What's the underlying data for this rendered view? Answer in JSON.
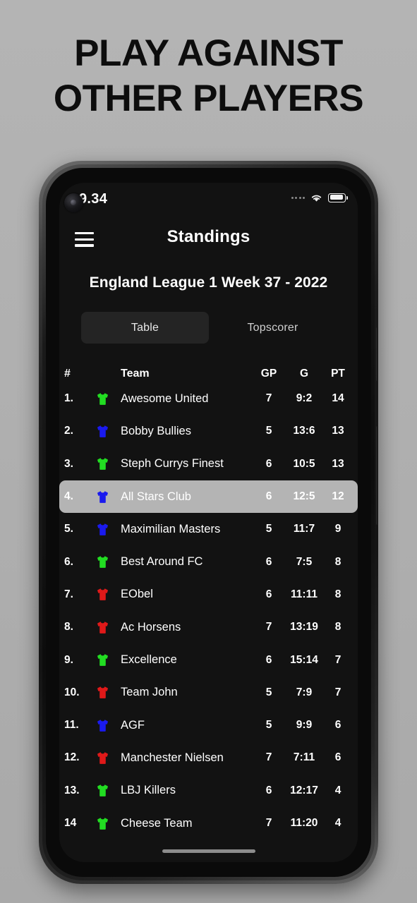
{
  "promo": {
    "line1": "PLAY AGAINST",
    "line2": "OTHER PLAYERS"
  },
  "statusbar": {
    "time": "9.34",
    "signal_icon": "signal-dots-icon",
    "wifi_icon": "wifi-icon",
    "battery_icon": "battery-full-icon"
  },
  "appbar": {
    "menu_icon": "hamburger-menu-icon",
    "title": "Standings"
  },
  "league": {
    "title": "England League 1 Week 37 - 2022"
  },
  "tabs": [
    {
      "label": "Table",
      "active": true
    },
    {
      "label": "Topscorer",
      "active": false
    }
  ],
  "table": {
    "headers": {
      "rank": "#",
      "team": "Team",
      "gp": "GP",
      "g": "G",
      "pt": "PT"
    },
    "rows": [
      {
        "rank": "1.",
        "jersey": "green",
        "team": "Awesome United",
        "gp": "7",
        "g": "9:2",
        "pt": "14",
        "highlight": false
      },
      {
        "rank": "2.",
        "jersey": "blue",
        "team": "Bobby Bullies",
        "gp": "5",
        "g": "13:6",
        "pt": "13",
        "highlight": false
      },
      {
        "rank": "3.",
        "jersey": "green",
        "team": "Steph Currys Finest",
        "gp": "6",
        "g": "10:5",
        "pt": "13",
        "highlight": false
      },
      {
        "rank": "4.",
        "jersey": "blue",
        "team": "All Stars Club",
        "gp": "6",
        "g": "12:5",
        "pt": "12",
        "highlight": true
      },
      {
        "rank": "5.",
        "jersey": "blue",
        "team": "Maximilian Masters",
        "gp": "5",
        "g": "11:7",
        "pt": "9",
        "highlight": false
      },
      {
        "rank": "6.",
        "jersey": "green",
        "team": "Best Around FC",
        "gp": "6",
        "g": "7:5",
        "pt": "8",
        "highlight": false
      },
      {
        "rank": "7.",
        "jersey": "red",
        "team": "EObel",
        "gp": "6",
        "g": "11:11",
        "pt": "8",
        "highlight": false
      },
      {
        "rank": "8.",
        "jersey": "red",
        "team": "Ac Horsens",
        "gp": "7",
        "g": "13:19",
        "pt": "8",
        "highlight": false
      },
      {
        "rank": "9.",
        "jersey": "green",
        "team": "Excellence",
        "gp": "6",
        "g": "15:14",
        "pt": "7",
        "highlight": false
      },
      {
        "rank": "10.",
        "jersey": "red",
        "team": "Team John",
        "gp": "5",
        "g": "7:9",
        "pt": "7",
        "highlight": false
      },
      {
        "rank": "11.",
        "jersey": "blue",
        "team": "AGF",
        "gp": "5",
        "g": "9:9",
        "pt": "6",
        "highlight": false
      },
      {
        "rank": "12.",
        "jersey": "red",
        "team": "Manchester Nielsen",
        "gp": "7",
        "g": "7:11",
        "pt": "6",
        "highlight": false
      },
      {
        "rank": "13.",
        "jersey": "green",
        "team": "LBJ Killers",
        "gp": "6",
        "g": "12:17",
        "pt": "4",
        "highlight": false
      },
      {
        "rank": "14",
        "jersey": "green",
        "team": "Cheese Team",
        "gp": "7",
        "g": "11:20",
        "pt": "4",
        "highlight": false
      }
    ]
  },
  "colors": {
    "jersey_green": "#22dd22",
    "jersey_blue": "#1a1aee",
    "jersey_red": "#e01919",
    "screen_bg": "#121212",
    "tab_active_bg": "#242424",
    "row_highlight_bg": "#b4b4b4",
    "promo_bg": "#b0b0b0"
  }
}
